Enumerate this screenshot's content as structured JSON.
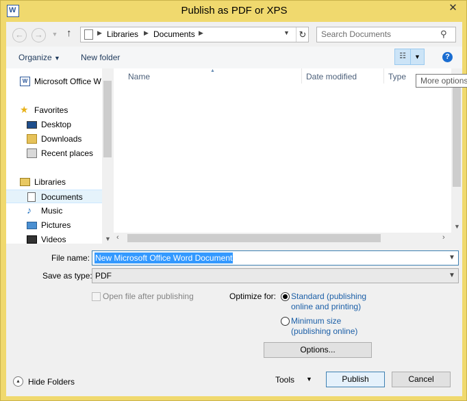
{
  "window": {
    "title": "Publish as PDF or XPS",
    "close": "✕"
  },
  "address": {
    "crumbs": [
      "Libraries",
      "Documents"
    ]
  },
  "search": {
    "placeholder": "Search Documents"
  },
  "toolbar": {
    "organize": "Organize",
    "new_folder": "New folder",
    "tooltip": "More options"
  },
  "nav": {
    "items": [
      {
        "label": "Microsoft Office W"
      },
      {
        "label": "Favorites"
      },
      {
        "label": "Desktop"
      },
      {
        "label": "Downloads"
      },
      {
        "label": "Recent places"
      },
      {
        "label": "Libraries"
      },
      {
        "label": "Documents",
        "selected": true
      },
      {
        "label": "Music"
      },
      {
        "label": "Pictures"
      },
      {
        "label": "Videos"
      }
    ]
  },
  "filelist": {
    "columns": [
      "Name",
      "Date modified",
      "Type"
    ]
  },
  "form": {
    "file_name_label": "File name:",
    "file_name_value": "New Microsoft Office Word Document",
    "save_type_label": "Save as type:",
    "save_type_value": "PDF",
    "open_after_label": "Open file after publishing",
    "optimize_label": "Optimize for:",
    "radio_standard_1": "Standard (publishing",
    "radio_standard_2": "online and printing)",
    "radio_min_1": "Minimum size",
    "radio_min_2": "(publishing online)",
    "options_button": "Options..."
  },
  "footer": {
    "hide_folders": "Hide Folders",
    "tools": "Tools",
    "publish": "Publish",
    "cancel": "Cancel"
  },
  "colors": {
    "frame": "#f0d96e",
    "accent": "#3399ff"
  }
}
